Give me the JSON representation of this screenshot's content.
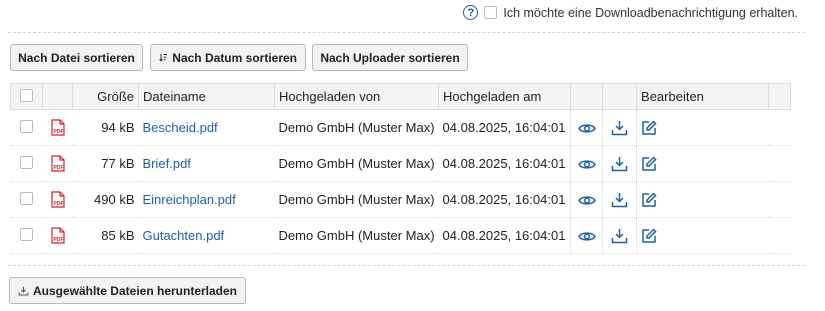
{
  "notification": {
    "label": "Ich möchte eine Downloadbenachrichtigung erhalten.",
    "checked": false
  },
  "sort_buttons": {
    "by_file": "Nach Datei sortieren",
    "by_date": "Nach Datum sortieren",
    "by_uploader": "Nach Uploader sortieren"
  },
  "table": {
    "headers": {
      "size": "Größe",
      "filename": "Dateiname",
      "uploaded_by": "Hochgeladen von",
      "uploaded_at": "Hochgeladen am",
      "edit": "Bearbeiten"
    },
    "rows": [
      {
        "size": "94 kB",
        "filename": "Bescheid.pdf",
        "uploader": "Demo GmbH (Muster Max)",
        "date": "04.08.2025, 16:04:01"
      },
      {
        "size": "77 kB",
        "filename": "Brief.pdf",
        "uploader": "Demo GmbH (Muster Max)",
        "date": "04.08.2025, 16:04:01"
      },
      {
        "size": "490 kB",
        "filename": "Einreichplan.pdf",
        "uploader": "Demo GmbH (Muster Max)",
        "date": "04.08.2025, 16:04:01"
      },
      {
        "size": "85 kB",
        "filename": "Gutachten.pdf",
        "uploader": "Demo GmbH (Muster Max)",
        "date": "04.08.2025, 16:04:01"
      }
    ]
  },
  "download_selected": "Ausgewählte Dateien herunterladen",
  "colors": {
    "link": "#1f5fa8",
    "pdf_icon": "#d9232d"
  }
}
